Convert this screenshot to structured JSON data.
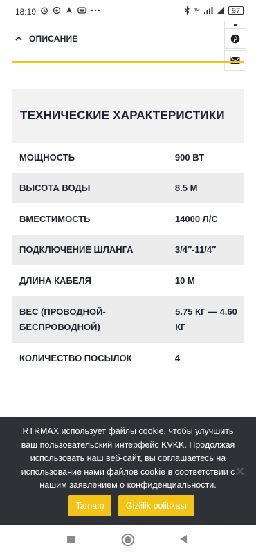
{
  "status": {
    "time": "18:19",
    "signal_label": "4G",
    "battery": "97"
  },
  "accordion": {
    "label": "ОПИСАНИЕ"
  },
  "specs": {
    "title": "ТЕХНИЧЕСКИЕ ХАРАКТЕРИСТИКИ",
    "rows": [
      {
        "key": "МОЩНОСТЬ",
        "value": "900 ВТ"
      },
      {
        "key": "ВЫСОТА ВОДЫ",
        "value": "8.5 М"
      },
      {
        "key": "ВМЕСТИМОСТЬ",
        "value": "14000 Л/С"
      },
      {
        "key": "ПОДКЛЮЧЕНИЕ ШЛАНГА",
        "value": "3/4″-11/4″"
      },
      {
        "key": "ДЛИНА КАБЕЛЯ",
        "value": "10 М"
      },
      {
        "key": "ВЕС (ПРОВОДНОЙ-БЕСПРОВОДНОЙ)",
        "value": "5.75 КГ — 4.60 КГ"
      },
      {
        "key": "КОЛИЧЕСТВО ПОСЫЛОК",
        "value": "4"
      }
    ]
  },
  "share": {
    "icons": [
      "pinterest-icon",
      "email-icon"
    ]
  },
  "cookie": {
    "text": "RTRMAX использует файлы cookie, чтобы улучшить ваш пользовательский интерфейс KVKK. Продолжая использовать наш веб-сайт, вы соглашаетесь на использование нами файлов cookie в соответствии с нашим заявлением о конфиденциальности.",
    "accept_label": "Tamam",
    "policy_label": "Gizlilik politikası"
  },
  "colors": {
    "accent": "#f2c418",
    "text_dark": "#1b2331",
    "banner_bg": "#2e3236",
    "row_alt": "#ececec",
    "title_bg": "#f2f2f2"
  }
}
